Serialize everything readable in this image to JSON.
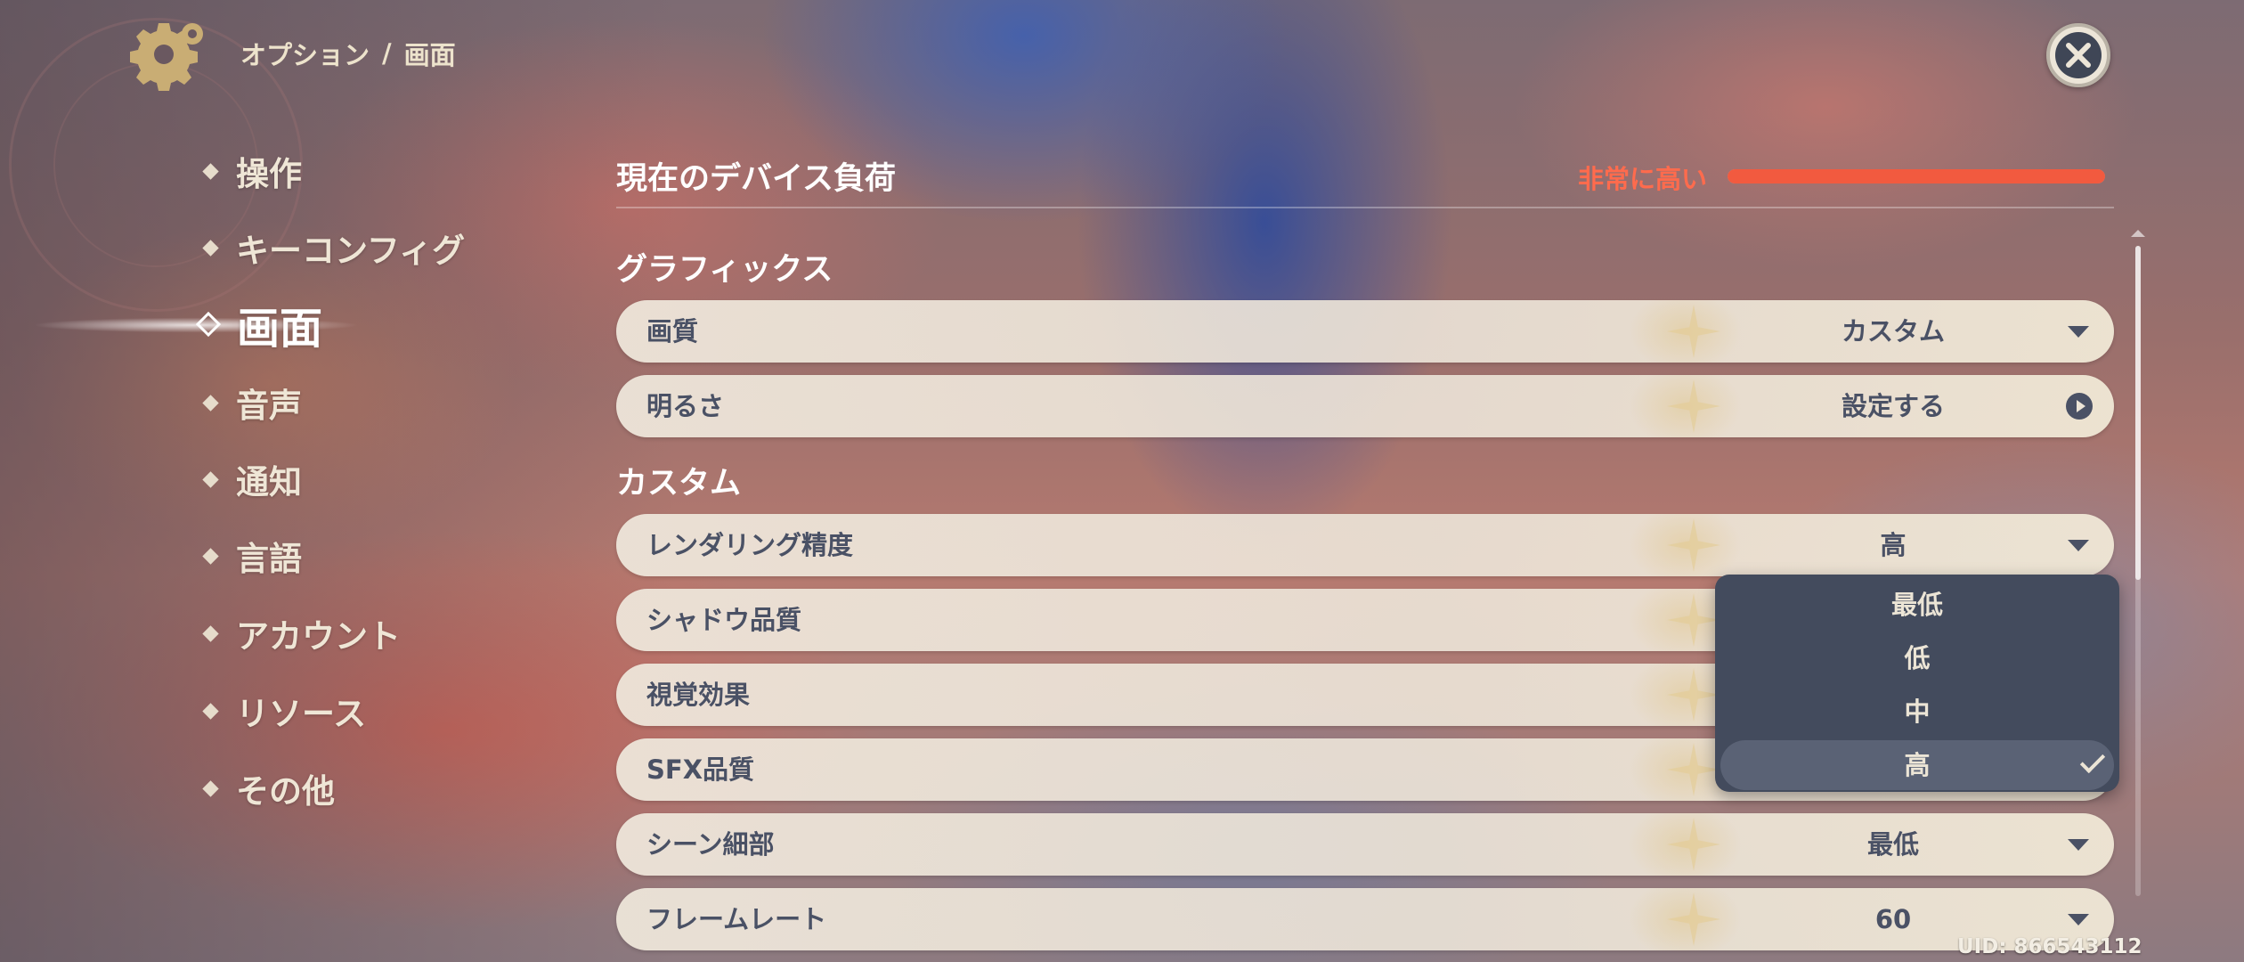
{
  "header": {
    "breadcrumb_parent": "オプション",
    "breadcrumb_separator": "/",
    "breadcrumb_current": "画面"
  },
  "nav": {
    "items": [
      {
        "label": "操作",
        "active": false
      },
      {
        "label": "キーコンフィグ",
        "active": false
      },
      {
        "label": "画面",
        "active": true
      },
      {
        "label": "音声",
        "active": false
      },
      {
        "label": "通知",
        "active": false
      },
      {
        "label": "言語",
        "active": false
      },
      {
        "label": "アカウント",
        "active": false
      },
      {
        "label": "リソース",
        "active": false
      },
      {
        "label": "その他",
        "active": false
      }
    ]
  },
  "device_load": {
    "title": "現在のデバイス負荷",
    "status": "非常に高い",
    "level": 1.0
  },
  "graphics": {
    "title": "グラフィックス",
    "rows": [
      {
        "label": "画質",
        "value": "カスタム",
        "icon": "chevron-down-icon"
      },
      {
        "label": "明るさ",
        "value": "設定する",
        "icon": "arrow-circle-icon"
      }
    ]
  },
  "custom": {
    "title": "カスタム",
    "rows": [
      {
        "label": "レンダリング精度",
        "value": "高"
      },
      {
        "label": "シャドウ品質",
        "value": ""
      },
      {
        "label": "視覚効果",
        "value": ""
      },
      {
        "label": "SFX品質",
        "value": ""
      },
      {
        "label": "シーン細部",
        "value": "最低"
      },
      {
        "label": "フレームレート",
        "value": "60"
      }
    ]
  },
  "dropdown": {
    "options": [
      "最低",
      "低",
      "中",
      "高"
    ],
    "selected": "高"
  },
  "footer": {
    "uid": "UID: 866543112"
  },
  "colors": {
    "accent_warning": "#ff6b4d",
    "load_bar": "#f25a3f",
    "row_text": "#4a5165",
    "dropdown_bg": "#434b5d"
  }
}
